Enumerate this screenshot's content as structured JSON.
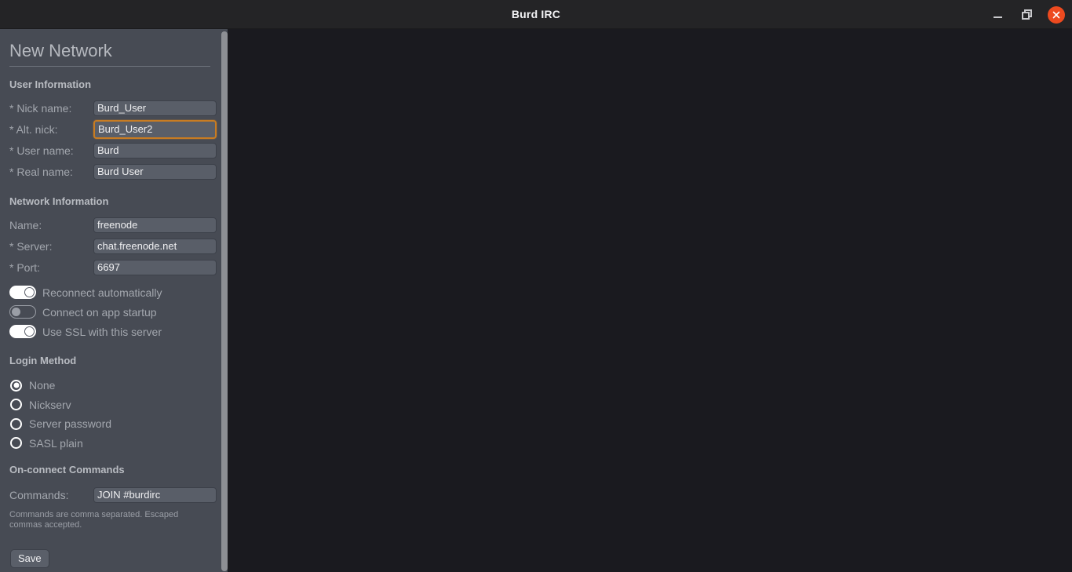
{
  "window": {
    "title": "Burd IRC",
    "controls": {
      "minimize_label": "Minimize",
      "maximize_label": "Maximize",
      "close_label": "Close"
    },
    "colors": {
      "titlebar_bg": "#242426",
      "close_button": "#ed4a1f",
      "sidebar_bg": "#474b54",
      "main_bg": "#1a1a1f",
      "focus_accent": "#c87c22",
      "scrollbar_thumb": "#8d8f94"
    }
  },
  "settings_pane": {
    "page_title": "New Network",
    "sections": {
      "user_information": {
        "heading": "User Information",
        "fields": [
          {
            "label": "* Nick name:",
            "value": "Burd_User",
            "focused": false
          },
          {
            "label": "* Alt. nick:",
            "value": "Burd_User2",
            "focused": true
          },
          {
            "label": "* User name:",
            "value": "Burd",
            "focused": false
          },
          {
            "label": "* Real name:",
            "value": "Burd User",
            "focused": false
          }
        ]
      },
      "network_information": {
        "heading": "Network Information",
        "fields": [
          {
            "label": "Name:",
            "value": "freenode",
            "focused": false
          },
          {
            "label": "* Server:",
            "value": "chat.freenode.net",
            "focused": false
          },
          {
            "label": "* Port:",
            "value": "6697",
            "focused": false
          }
        ],
        "toggles": [
          {
            "label": "Reconnect automatically",
            "on": true
          },
          {
            "label": "Connect on app startup",
            "on": false
          },
          {
            "label": "Use SSL with this server",
            "on": true
          }
        ]
      },
      "login_method": {
        "heading": "Login Method",
        "options": [
          {
            "label": "None",
            "checked": true
          },
          {
            "label": "Nickserv",
            "checked": false
          },
          {
            "label": "Server password",
            "checked": false
          },
          {
            "label": "SASL plain",
            "checked": false
          }
        ]
      },
      "on_connect_commands": {
        "heading": "On-connect Commands",
        "field": {
          "label": "Commands:",
          "value": "JOIN #burdirc"
        },
        "help_text": "Commands are comma separated. Escaped commas accepted."
      }
    },
    "save_label": "Save"
  }
}
